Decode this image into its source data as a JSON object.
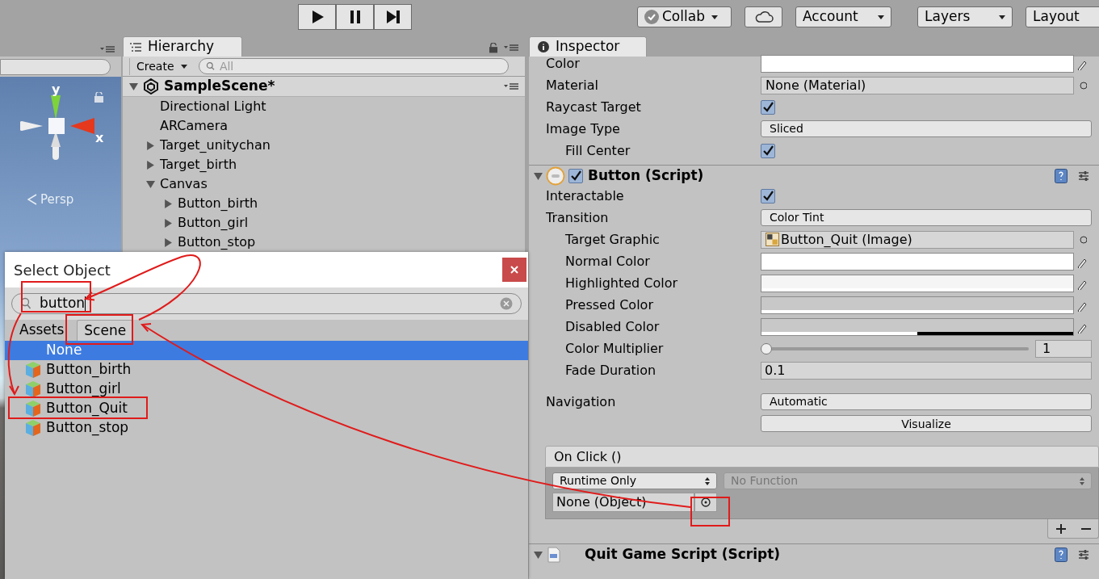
{
  "toolbar": {
    "playback": [
      {
        "kind": "play"
      },
      {
        "kind": "pause"
      },
      {
        "kind": "step"
      }
    ],
    "right": [
      {
        "kind": "collab",
        "label": "Collab"
      },
      {
        "kind": "cloud"
      },
      {
        "kind": "dropdown",
        "label": "Account"
      },
      {
        "kind": "dropdown",
        "label": "Layers"
      },
      {
        "kind": "dropdown",
        "label": "Layout"
      }
    ]
  },
  "scene": {
    "axis_y": "y",
    "axis_x": "x",
    "projection": "Persp"
  },
  "hierarchy": {
    "tab": "Hierarchy",
    "create": "Create",
    "search_placeholder": "All",
    "scene": "SampleScene*",
    "items": [
      {
        "label": "Directional Light"
      },
      {
        "label": "ARCamera"
      },
      {
        "label": "Target_unitychan",
        "expanded": false
      },
      {
        "label": "Target_birth",
        "expanded": false
      },
      {
        "label": "Canvas",
        "expanded": true,
        "children": [
          {
            "label": "Button_birth",
            "expanded": false
          },
          {
            "label": "Button_girl",
            "expanded": false
          },
          {
            "label": "Button_stop",
            "expanded": false
          }
        ]
      }
    ]
  },
  "dialog": {
    "title": "Select Object",
    "search_value": "button",
    "tabs": [
      {
        "label": "Assets",
        "selected": false
      },
      {
        "label": "Scene",
        "selected": true
      }
    ],
    "items": [
      {
        "label": "None",
        "kind": "none",
        "selected": true
      },
      {
        "label": "Button_birth",
        "kind": "gameobject",
        "selected": false
      },
      {
        "label": "Button_girl",
        "kind": "gameobject",
        "selected": false
      },
      {
        "label": "Button_Quit",
        "kind": "gameobject",
        "selected": false
      },
      {
        "label": "Button_stop",
        "kind": "gameobject",
        "selected": false
      }
    ]
  },
  "inspector": {
    "tab": "Inspector",
    "image_rows": [
      {
        "kind": "color",
        "label": "Color",
        "color": "#ffffff",
        "level": 1
      },
      {
        "kind": "object",
        "label": "Material",
        "value": "None (Material)"
      },
      {
        "kind": "checkbox",
        "label": "Raycast Target",
        "checked": true
      },
      {
        "kind": "dropdown",
        "label": "Image Type",
        "value": "Sliced",
        "children": [
          {
            "kind": "checkbox",
            "label": "Fill Center",
            "checked": true
          }
        ]
      }
    ],
    "button_component": {
      "title": "Button (Script)",
      "enabled": true,
      "rows": [
        {
          "kind": "checkbox",
          "label": "Interactable",
          "checked": true
        },
        {
          "kind": "dropdown",
          "label": "Transition",
          "value": "Color Tint",
          "children": [
            {
              "kind": "image_object",
              "label": "Target Graphic",
              "value": "Button_Quit (Image)"
            },
            {
              "kind": "color",
              "label": "Normal Color",
              "color": "#ffffff",
              "level": 1
            },
            {
              "kind": "color",
              "label": "Highlighted Color",
              "color": "#f5f5f5",
              "level": 1
            },
            {
              "kind": "color",
              "label": "Pressed Color",
              "color": "#c8c8c8",
              "level": 1
            },
            {
              "kind": "color",
              "label": "Disabled Color",
              "color": "#c8c8c8",
              "level": 0.5
            },
            {
              "kind": "slider",
              "label": "Color Multiplier",
              "level": 0,
              "reading": "1"
            },
            {
              "kind": "number",
              "label": "Fade Duration",
              "value": "0.1"
            }
          ]
        },
        {
          "kind": "gap"
        },
        {
          "kind": "dropdown",
          "label": "Navigation",
          "value": "Automatic"
        },
        {
          "kind": "button",
          "value": "Visualize"
        }
      ]
    },
    "on_click": {
      "title": "On Click ()",
      "runtime": "Runtime Only",
      "function": "No Function",
      "function_disabled": true,
      "object": "None (Object)"
    },
    "next_component": {
      "title": "Quit Game Script (Script)"
    }
  }
}
